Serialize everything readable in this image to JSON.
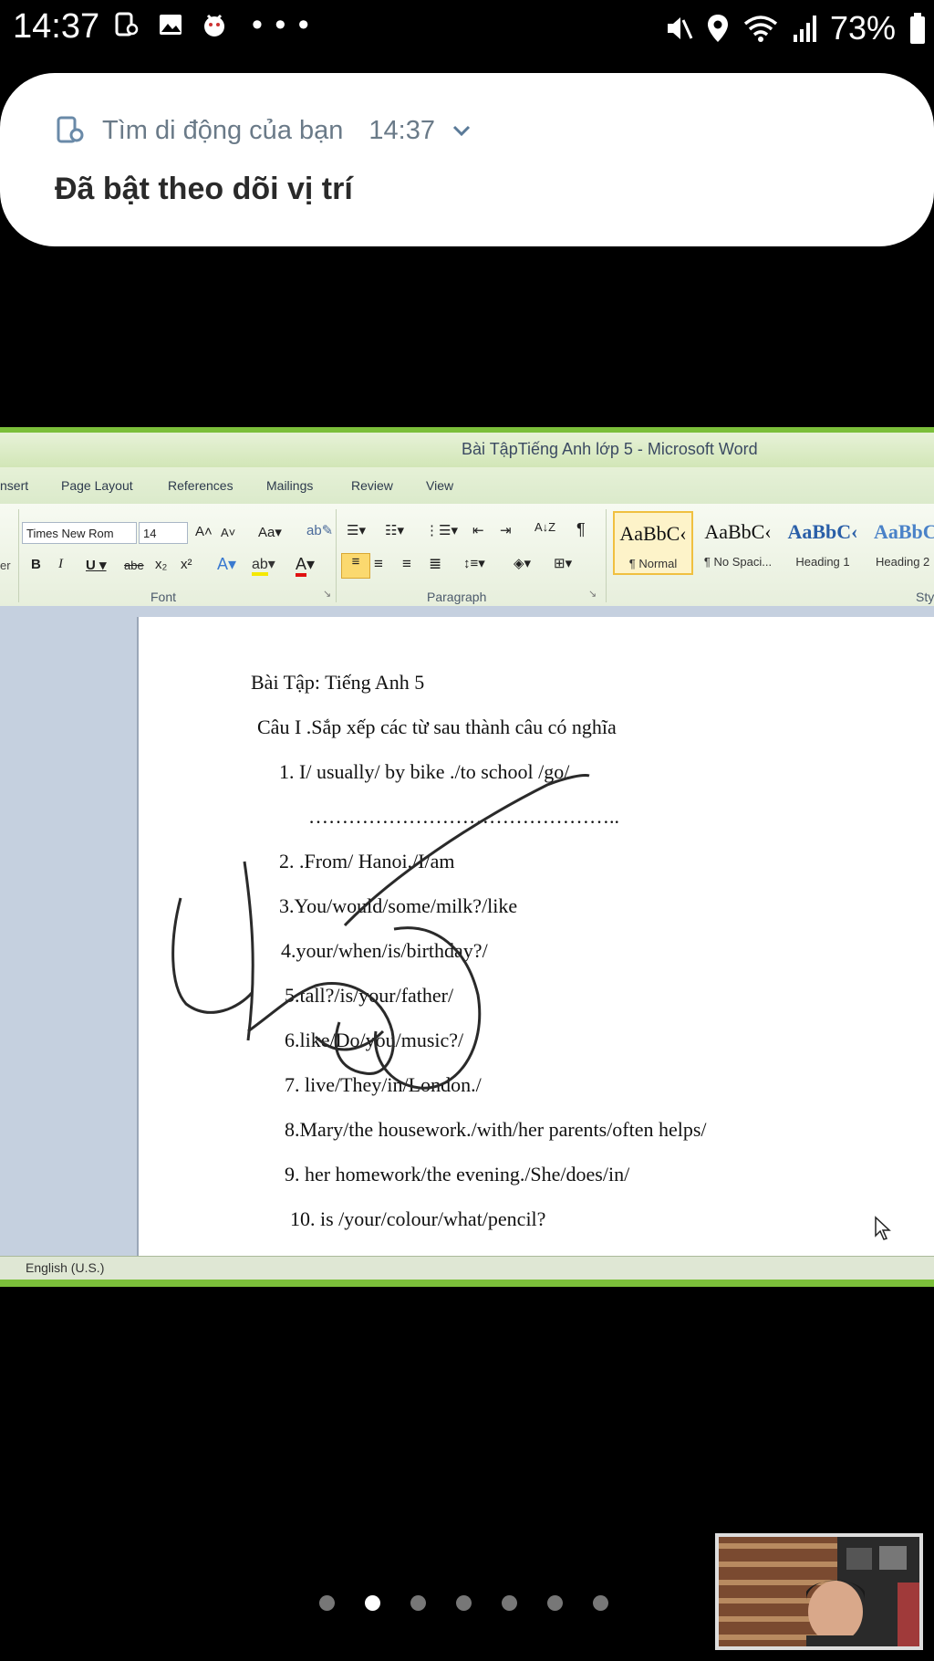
{
  "status_bar": {
    "time": "14:37",
    "battery": "73%"
  },
  "notification": {
    "app_name": "Tìm di động của bạn",
    "time": "14:37",
    "title": "Đã bật theo dõi vị trí"
  },
  "word": {
    "window_title": "Bài TậpTiếng Anh lớp 5  -  Microsoft Word",
    "tabs": [
      "nsert",
      "Page Layout",
      "References",
      "Mailings",
      "Review",
      "View"
    ],
    "font_name": "Times New Rom",
    "font_size": "14",
    "group_font": "Font",
    "group_paragraph": "Paragraph",
    "group_styles": "Sty",
    "left_edge_label": "er",
    "styles": [
      {
        "sample": "AaBbC‹",
        "name": "¶ Normal"
      },
      {
        "sample": "AaBbC‹",
        "name": "¶ No Spaci..."
      },
      {
        "sample": "AaBbC‹",
        "name": "Heading 1"
      },
      {
        "sample": "AaBbC",
        "name": "Heading 2"
      }
    ],
    "document": {
      "heading": "Bài Tập:  Tiếng Anh 5",
      "question": "Câu I .Sắp xếp các từ sau thành câu có nghĩa",
      "items": [
        "1.    I/ usually/ by bike ./to school /go/",
        "………………………………………..",
        "2.   .From/ Hanoi./I/am",
        "3.You/would/some/milk?/like",
        "4.your/when/is/birthday?/",
        "5.tall?/is/your/father/",
        "6.like/Do/you/music?/",
        "7. live/They/in/London./",
        "8.Mary/the housework./with/her parents/often helps/",
        "9. her homework/the evening./She/does/in/",
        "10. is /your/colour/what/pencil?"
      ]
    },
    "status_language": "English (U.S.)"
  },
  "pager": {
    "count": 7,
    "active_index": 1
  },
  "colors": {
    "word_green": "#7bbf3a",
    "notification_bg": "#ffffff",
    "ink": "#2a2a2a"
  }
}
